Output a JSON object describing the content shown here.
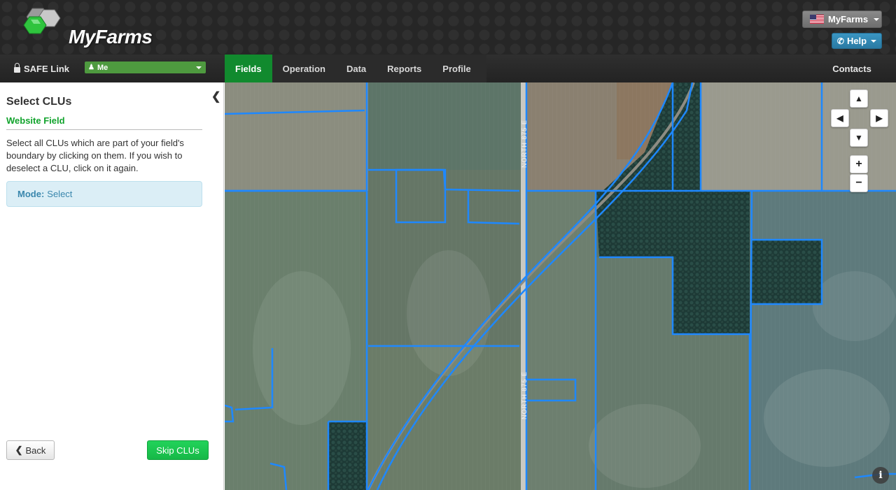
{
  "header": {
    "logo_text": "MyFarms",
    "account_label": "MyFarms",
    "help_label": "Help"
  },
  "nav": {
    "safe_link": "SAFE Link",
    "user_select": "Me",
    "tabs": [
      "Fields",
      "Operation",
      "Data",
      "Reports",
      "Profile"
    ],
    "active_tab": "Fields",
    "contacts": "Contacts"
  },
  "panel": {
    "title": "Select CLUs",
    "subtitle": "Website Field",
    "description": "Select all CLUs which are part of your field's boundary by clicking on them. If you wish to deselect a CLU, click on it again.",
    "mode_label": "Mode:",
    "mode_value": "Select",
    "back_label": "Back",
    "skip_label": "Skip CLUs"
  },
  "map": {
    "road_labels": [
      "NORTH 875 E",
      "NORTH 875 E"
    ],
    "controls": {
      "pan_up": "▲",
      "pan_left": "◀",
      "pan_right": "▶",
      "pan_down": "▼",
      "zoom_in": "+",
      "zoom_out": "−"
    },
    "info_icon": "i",
    "boundary_color": "#1e88ff"
  },
  "colors": {
    "header_bg": "#262626",
    "nav_active": "#118a2e",
    "subtitle_green": "#11a32c",
    "skip_green": "#16b847",
    "help_blue": "#2a7aa3",
    "mode_bg": "#dbeef6"
  }
}
